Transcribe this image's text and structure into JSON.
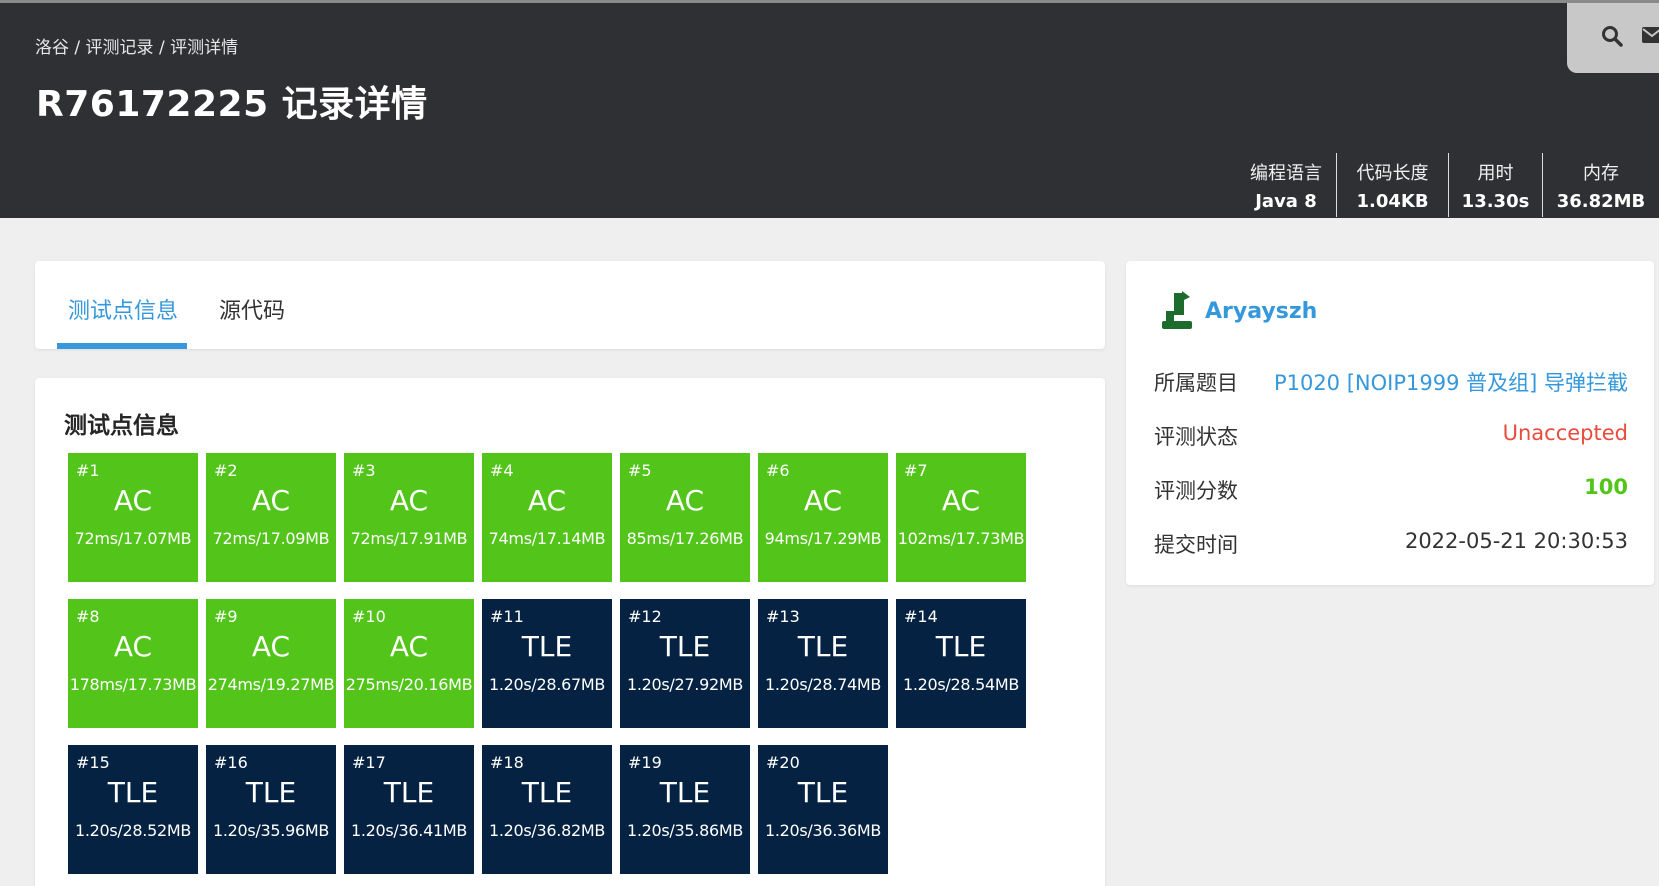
{
  "breadcrumb": {
    "home": "洛谷",
    "sep1": " / ",
    "records": "评测记录",
    "sep2": " / ",
    "current": "评测详情"
  },
  "title": "R76172225 记录详情",
  "icons": {
    "search": "search-icon",
    "mail": "mail-icon"
  },
  "stats": [
    {
      "label": "编程语言",
      "value": "Java 8"
    },
    {
      "label": "代码长度",
      "value": "1.04KB"
    },
    {
      "label": "用时",
      "value": "13.30s"
    },
    {
      "label": "内存",
      "value": "36.82MB"
    }
  ],
  "tabs": {
    "cases": "测试点信息",
    "source": "源代码"
  },
  "cases_title": "测试点信息",
  "colors": {
    "ac": "#52c41a",
    "tle": "#052242",
    "link": "#3498db",
    "unaccepted": "#e74c3c"
  },
  "testcases": [
    {
      "id": "#1",
      "status": "AC",
      "result": "72ms/17.07MB"
    },
    {
      "id": "#2",
      "status": "AC",
      "result": "72ms/17.09MB"
    },
    {
      "id": "#3",
      "status": "AC",
      "result": "72ms/17.91MB"
    },
    {
      "id": "#4",
      "status": "AC",
      "result": "74ms/17.14MB"
    },
    {
      "id": "#5",
      "status": "AC",
      "result": "85ms/17.26MB"
    },
    {
      "id": "#6",
      "status": "AC",
      "result": "94ms/17.29MB"
    },
    {
      "id": "#7",
      "status": "AC",
      "result": "102ms/17.73MB"
    },
    {
      "id": "#8",
      "status": "AC",
      "result": "178ms/17.73MB"
    },
    {
      "id": "#9",
      "status": "AC",
      "result": "274ms/19.27MB"
    },
    {
      "id": "#10",
      "status": "AC",
      "result": "275ms/20.16MB"
    },
    {
      "id": "#11",
      "status": "TLE",
      "result": "1.20s/28.67MB"
    },
    {
      "id": "#12",
      "status": "TLE",
      "result": "1.20s/27.92MB"
    },
    {
      "id": "#13",
      "status": "TLE",
      "result": "1.20s/28.74MB"
    },
    {
      "id": "#14",
      "status": "TLE",
      "result": "1.20s/28.54MB"
    },
    {
      "id": "#15",
      "status": "TLE",
      "result": "1.20s/28.52MB"
    },
    {
      "id": "#16",
      "status": "TLE",
      "result": "1.20s/35.96MB"
    },
    {
      "id": "#17",
      "status": "TLE",
      "result": "1.20s/36.41MB"
    },
    {
      "id": "#18",
      "status": "TLE",
      "result": "1.20s/36.82MB"
    },
    {
      "id": "#19",
      "status": "TLE",
      "result": "1.20s/35.86MB"
    },
    {
      "id": "#20",
      "status": "TLE",
      "result": "1.20s/36.36MB"
    }
  ],
  "info": {
    "username": "Aryayszh",
    "problem_label": "所属题目",
    "problem_value": "P1020 [NOIP1999 普及组] 导弹拦截",
    "status_label": "评测状态",
    "status_value": "Unaccepted",
    "score_label": "评测分数",
    "score_value": "100",
    "time_label": "提交时间",
    "time_value": "2022-05-21 20:30:53"
  }
}
